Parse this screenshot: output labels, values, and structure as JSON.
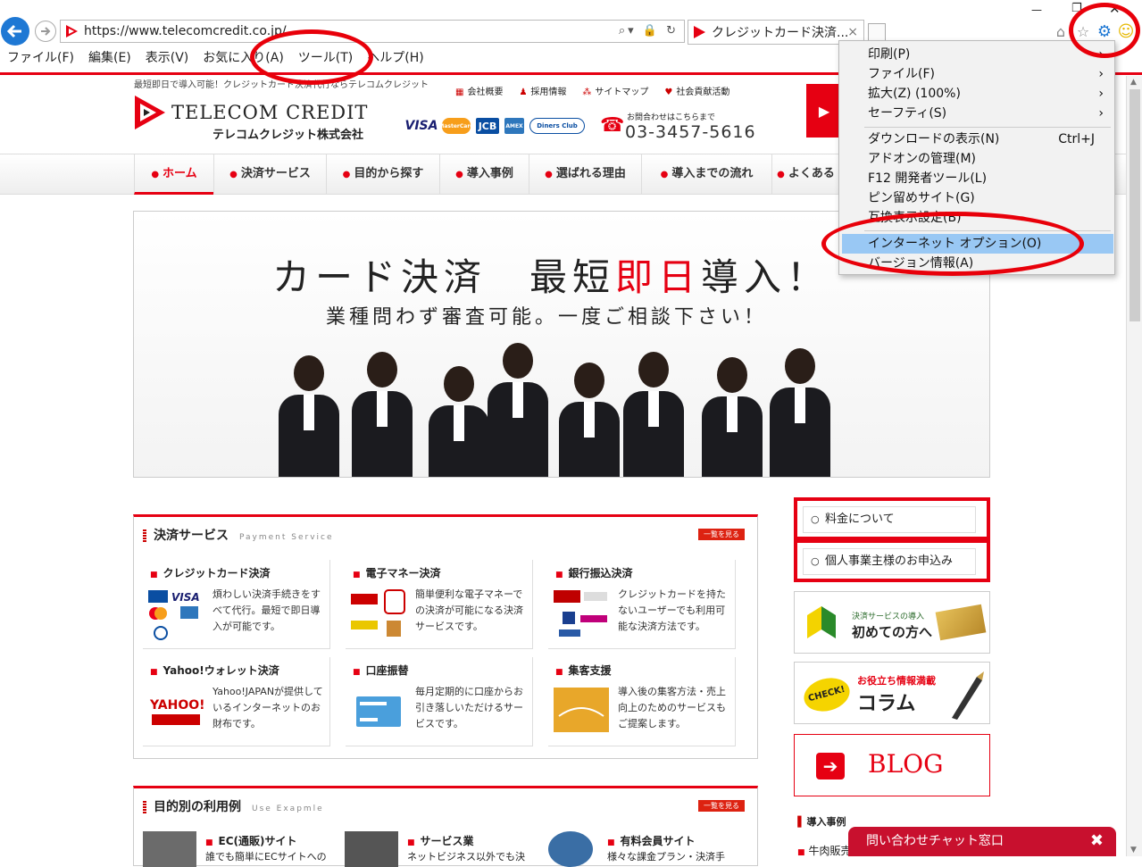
{
  "browser": {
    "url": "https://www.telecomcredit.co.jp/",
    "tab_title": "クレジットカード決済...",
    "menubar": [
      "ファイル(F)",
      "編集(E)",
      "表示(V)",
      "お気に入り(A)",
      "ツール(T)",
      "ヘルプ(H)"
    ]
  },
  "tools_menu": {
    "items": [
      {
        "label": "印刷(P)",
        "shortcut": "",
        "arrow": "›"
      },
      {
        "label": "ファイル(F)",
        "shortcut": "",
        "arrow": "›"
      },
      {
        "label": "拡大(Z) (100%)",
        "shortcut": "",
        "arrow": "›"
      },
      {
        "label": "セーフティ(S)",
        "shortcut": "",
        "arrow": "›"
      },
      {
        "label": "ダウンロードの表示(N)",
        "shortcut": "Ctrl+J",
        "arrow": ""
      },
      {
        "label": "アドオンの管理(M)",
        "shortcut": "",
        "arrow": ""
      },
      {
        "label": "F12 開発者ツール(L)",
        "shortcut": "",
        "arrow": ""
      },
      {
        "label": "ピン留めサイト(G)",
        "shortcut": "",
        "arrow": ""
      },
      {
        "label": "互換表示設定(B)",
        "shortcut": "",
        "arrow": ""
      },
      {
        "label": "インターネット オプション(O)",
        "shortcut": "",
        "arrow": ""
      },
      {
        "label": "バージョン情報(A)",
        "shortcut": "",
        "arrow": ""
      }
    ],
    "highlighted": "インターネット オプション(O)"
  },
  "site": {
    "tagline": "最短即日で導入可能！クレジットカード決済代行ならテレコムクレジット",
    "toplinks": [
      "会社概要",
      "採用情報",
      "サイトマップ",
      "社会貢献活動"
    ],
    "logo_en": "TELECOM CREDIT",
    "logo_ja": "テレコムクレジット株式会社",
    "cards": [
      "VISA",
      "MasterCard",
      "JCB",
      "AMEX",
      "Diners Club"
    ],
    "contact_label": "お問合わせはこちらまで",
    "contact_number": "03-3457-5616",
    "nav": [
      "ホーム",
      "決済サービス",
      "目的から探す",
      "導入事例",
      "選ばれる理由",
      "導入までの流れ",
      "よくある"
    ],
    "hero_line1_a": "カード決済　最短",
    "hero_line1_red": "即日",
    "hero_line1_b": "導入！",
    "hero_line2": "業種問わず審査可能。一度ご相談下さい！"
  },
  "services": {
    "title": "決済サービス",
    "title_en": "Payment Service",
    "more": "一覧を見る",
    "items": [
      {
        "title": "クレジットカード決済",
        "desc": "煩わしい決済手続きをすべて代行。最短で即日導入が可能です。"
      },
      {
        "title": "電子マネー決済",
        "desc": "簡単便利な電子マネーでの決済が可能になる決済サービスです。"
      },
      {
        "title": "銀行振込決済",
        "desc": "クレジットカードを持たないユーザーでも利用可能な決済方法です。"
      },
      {
        "title": "Yahoo!ウォレット決済",
        "desc": "Yahoo!JAPANが提供しているインターネットのお財布です。"
      },
      {
        "title": "口座振替",
        "desc": "毎月定期的に口座からお引き落しいただけるサービスです。"
      },
      {
        "title": "集客支援",
        "desc": "導入後の集客方法・売上向上のためのサービスもご提案します。"
      }
    ]
  },
  "usecases": {
    "title": "目的別の利用例",
    "title_en": "Use Exapmle",
    "more": "一覧を見る",
    "items": [
      {
        "title": "EC(通販)サイト",
        "desc": "誰でも簡単にECサイトへの"
      },
      {
        "title": "サービス業",
        "desc": "ネットビジネス以外でも決"
      },
      {
        "title": "有料会員サイト",
        "desc": "様々な課金プラン・決済手"
      }
    ]
  },
  "sidebar": {
    "btn1": "料金について",
    "btn2": "個人事業主様のお申込み",
    "banner1_small": "決済サービスの導入",
    "banner1_big": "初めての方へ",
    "banner2_small": "お役立ち情報満載",
    "banner2_big": "コラム",
    "banner2_check": "CHECK!",
    "blog": "BLOG",
    "cases_title": "導入事例",
    "cases_item": "牛肉販売"
  },
  "chat": {
    "label": "問い合わせチャット窓口",
    "close": "✖"
  },
  "colors": {
    "brand_red": "#e60012",
    "highlight": "#99c8f4",
    "annotation": "#e8000a"
  }
}
